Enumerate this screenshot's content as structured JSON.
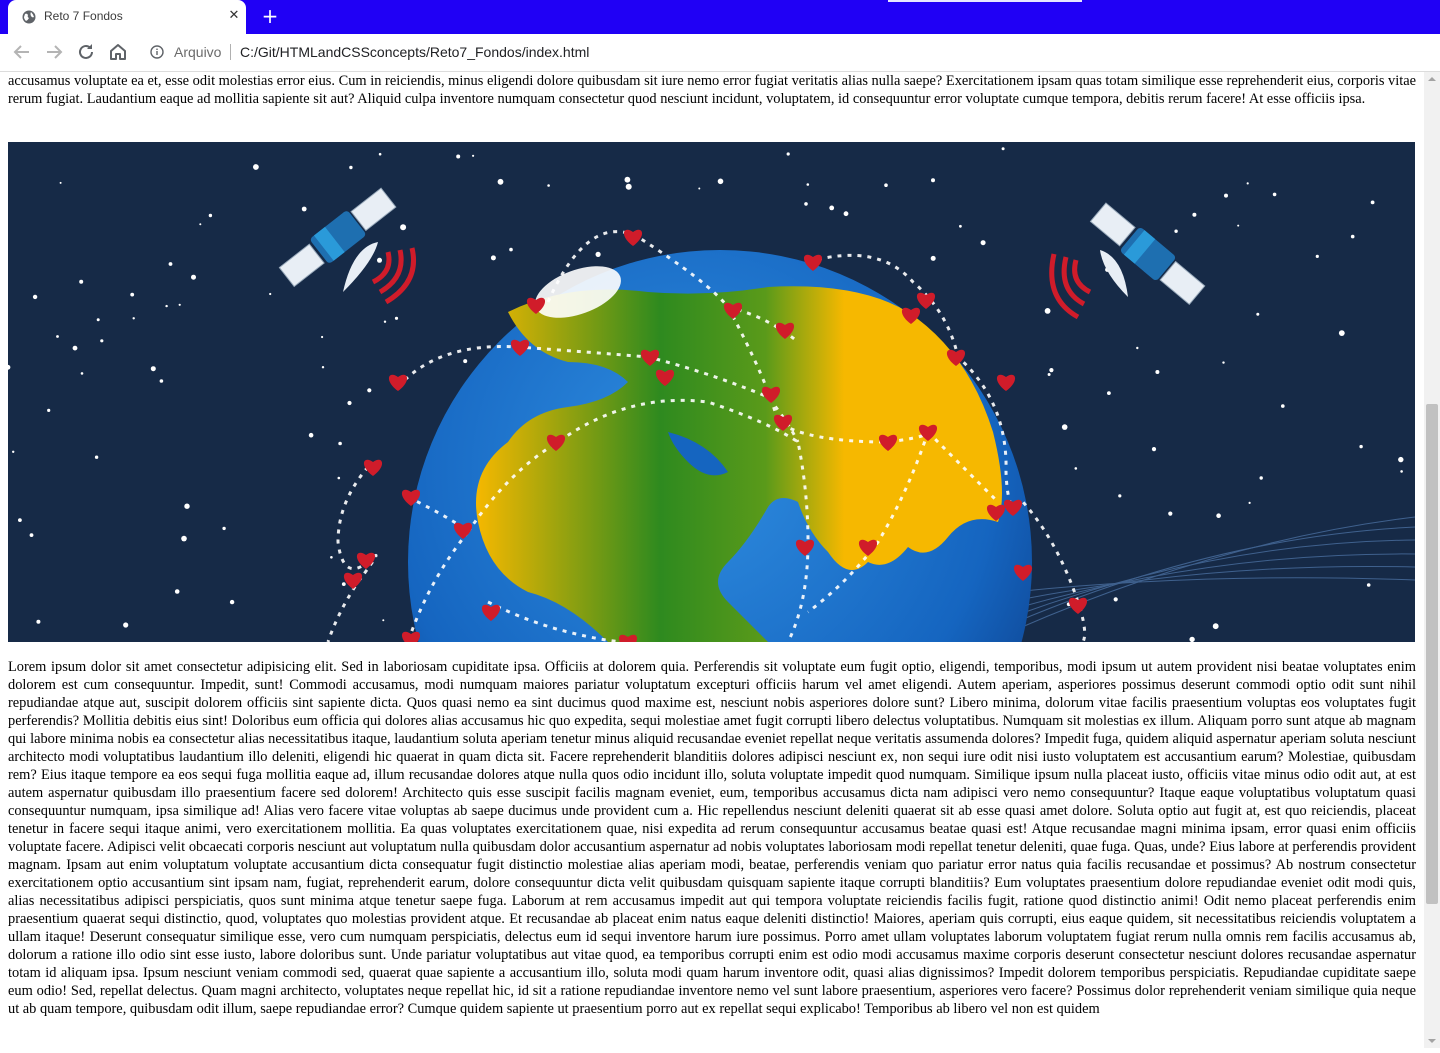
{
  "browser": {
    "tab_title": "Reto 7 Fondos",
    "new_tab_label": "+",
    "close_label": "✕",
    "scheme_label": "Arquivo",
    "url": "C:/Git/HTMLandCSSconcepts/Reto7_Fondos/index.html"
  },
  "icons": {
    "favicon": "globe-icon",
    "back": "arrow-left-icon",
    "forward": "arrow-right-icon",
    "reload": "reload-icon",
    "home": "home-icon",
    "info": "info-icon",
    "close": "close-icon"
  },
  "colors": {
    "tabbar": "#2000f5",
    "hero_bg": "#162a47",
    "heart": "#d01c2a",
    "land_yellow": "#f6b800",
    "land_green": "#2e8a1f",
    "ocean": "#1565c0"
  },
  "page": {
    "intro_text": "accusamus voluptate ea et, esse odit molestias error eius. Cum in reiciendis, minus eligendi dolore quibusdam sit iure nemo error fugiat veritatis alias nulla saepe? Exercitationem ipsam quas totam similique esse reprehenderit eius, corporis vitae rerum fugiat. Laudantium eaque ad mollitia sapiente sit aut? Aliquid culpa inventore numquam consectetur quod nesciunt incidunt, voluptatem, id consequuntur error voluptate cumque tempora, debitis rerum facere! At esse officiis ipsa.",
    "body_text": "Lorem ipsum dolor sit amet consectetur adipisicing elit. Sed in laboriosam cupiditate ipsa. Officiis at dolorem quia. Perferendis sit voluptate eum fugit optio, eligendi, temporibus, modi ipsum ut autem provident nisi beatae voluptates enim dolorem est cum consequuntur. Impedit, sunt! Commodi accusamus, modi numquam maiores pariatur voluptatum excepturi officiis harum vel amet eligendi. Autem aperiam, asperiores possimus deserunt commodi optio odit sunt nihil repudiandae atque aut, suscipit dolorem officiis sint sapiente dicta. Quos quasi nemo ea sint ducimus quod maxime est, nesciunt nobis asperiores dolore sunt? Libero minima, dolorum vitae facilis praesentium voluptas eos voluptates fugit perferendis? Mollitia debitis eius sint! Doloribus eum officia qui dolores alias accusamus hic quo expedita, sequi molestiae amet fugit corrupti libero delectus voluptatibus. Numquam sit molestias ex illum. Aliquam porro sunt atque ab magnam qui labore minima nobis ea consectetur alias necessitatibus itaque, laudantium soluta aperiam tenetur minus aliquid recusandae eveniet repellat neque veritatis assumenda dolores? Impedit fuga, quidem aliquid aspernatur aperiam soluta nesciunt architecto modi voluptatibus laudantium illo deleniti, eligendi hic quaerat in quam dicta sit. Facere reprehenderit blanditiis dolores adipisci nesciunt ex, non sequi iure odit nisi iusto voluptatem est accusantium earum? Molestiae, quibusdam rem? Eius itaque tempore ea eos sequi fuga mollitia eaque ad, illum recusandae dolores atque nulla quos odio incidunt illo, soluta voluptate impedit quod numquam. Similique ipsum nulla placeat iusto, officiis vitae minus odio odit aut, at est autem aspernatur quibusdam illo praesentium facere sed dolorem! Architecto quis esse suscipit facilis magnam eveniet, eum, temporibus accusamus dicta nam adipisci vero nemo consequuntur? Itaque eaque voluptatibus voluptatum quasi consequuntur numquam, ipsa similique ad! Alias vero facere vitae voluptas ab saepe ducimus unde provident cum a. Hic repellendus nesciunt deleniti quaerat sit ab esse quasi amet dolore. Soluta optio aut fugit at, est quo reiciendis, placeat tenetur in facere sequi itaque animi, vero exercitationem mollitia. Ea quas voluptates exercitationem quae, nisi expedita ad rerum consequuntur accusamus beatae quasi est! Atque recusandae magni minima ipsam, error quasi enim officiis voluptate facere. Adipisci velit obcaecati corporis nesciunt aut voluptatum nulla quibusdam dolor accusantium aspernatur ad nobis voluptates laboriosam modi repellat tenetur deleniti, quae fuga. Quas, unde? Eius labore at perferendis provident magnam. Ipsam aut enim voluptatum voluptate accusantium dicta consequatur fugit distinctio molestiae alias aperiam modi, beatae, perferendis veniam quo pariatur error natus quia facilis recusandae et possimus? Ab nostrum consectetur exercitationem optio accusantium sint ipsam nam, fugiat, reprehenderit earum, dolore consequuntur dicta velit quibusdam quisquam sapiente itaque corrupti blanditiis? Eum voluptates praesentium dolore repudiandae eveniet odit modi quis, alias necessitatibus adipisci perspiciatis, quos sunt minima atque tenetur saepe fuga. Laborum at rem accusamus impedit aut qui tempora voluptate reiciendis facilis fugit, ratione quod distinctio animi! Odit nemo placeat perferendis enim praesentium quaerat sequi distinctio, quod, voluptates quo molestias provident atque. Et recusandae ab placeat enim natus eaque deleniti distinctio! Maiores, aperiam quis corrupti, eius eaque quidem, sit necessitatibus reiciendis voluptatem a ullam itaque! Deserunt consequatur similique esse, vero cum numquam perspiciatis, delectus eum id sequi inventore harum iure possimus. Porro amet ullam voluptates laborum voluptatem fugiat rerum nulla omnis rem facilis accusamus ab, dolorum a ratione illo odio sint esse iusto, labore doloribus sunt. Unde pariatur voluptatibus aut vitae quod, ea temporibus corrupti enim est odio modi accusamus maxime corporis deserunt consectetur nesciunt dolores recusandae aspernatur totam id aliquam ipsa. Ipsum nesciunt veniam commodi sed, quaerat quae sapiente a accusantium illo, soluta modi quam harum inventore odit, quasi alias dignissimos? Impedit dolorem temporibus perspiciatis. Repudiandae cupiditate saepe eum odio! Sed, repellat delectus. Quam magni architecto, voluptates neque repellat hic, id sit a ratione repudiandae inventore nemo vel sunt labore praesentium, asperiores vero facere? Possimus dolor reprehenderit veniam similique quia neque ut ab quam tempore, quibusdam odit illum, saepe repudiandae error? Cumque quidem sapiente ut praesentium porro aut ex repellat sequi explicabo! Temporibus ab libero vel non est quidem"
  }
}
